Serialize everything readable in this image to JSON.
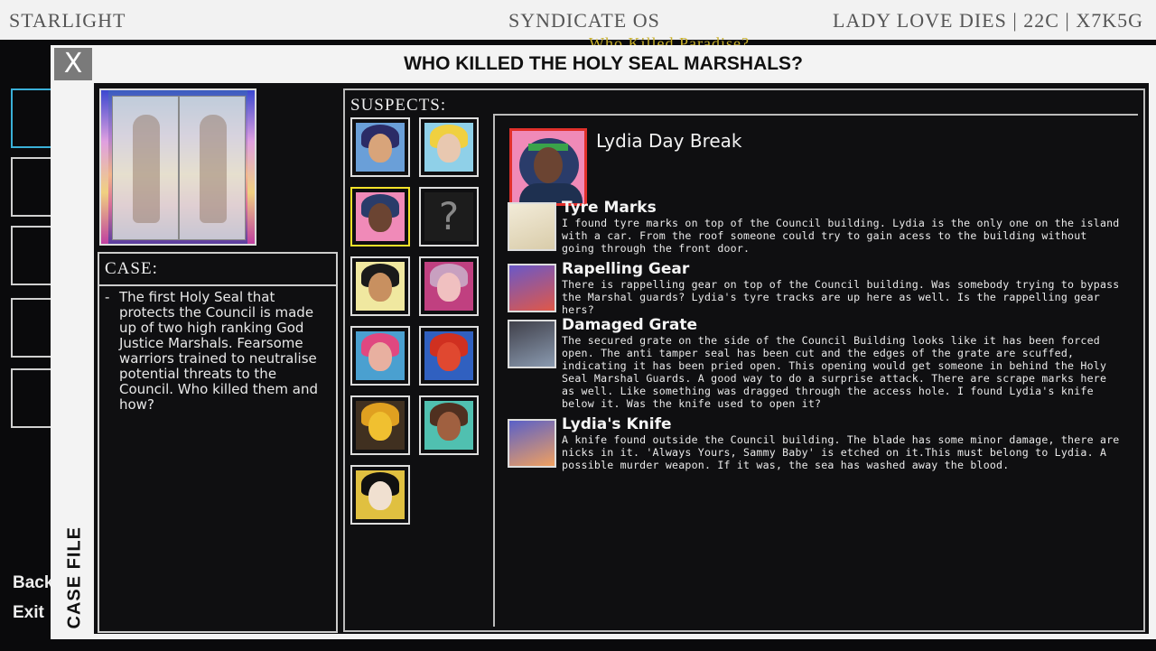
{
  "os": {
    "left_label": "STARLIGHT",
    "center_label": "SYNDICATE OS",
    "right_label": "LADY LOVE DIES | 22C | X7K5G",
    "sub_title": "Who Killed Paradise?",
    "side_labels": [
      "Back",
      "Exit"
    ]
  },
  "dialog": {
    "close_label": "X",
    "title": "WHO KILLED THE HOLY SEAL MARSHALS?",
    "tab_label": "CASE FILE"
  },
  "case": {
    "heading": "CASE:",
    "dash": "-",
    "text": "The first Holy Seal that protects the Council is made up of two high ranking God Justice Marshals. Fearsome warriors trained to neutralise potential threats to the Council. Who killed them and how?"
  },
  "suspects": {
    "heading": "SUSPECTS:",
    "unknown_label": "?",
    "list": [
      {
        "hair": "#2b2b66",
        "face": "#d8a47a",
        "bg": "#6a9fd8"
      },
      {
        "hair": "#f0d040",
        "face": "#e8c8b0",
        "bg": "#8fd0e8"
      },
      {
        "hair": "#2a3c6a",
        "face": "#6b4432",
        "bg": "#f08ab8",
        "selected": true
      },
      {
        "unknown": true
      },
      {
        "hair": "#1a1a1a",
        "face": "#c89060",
        "bg": "#f0e8a0"
      },
      {
        "hair": "#c8a0c0",
        "face": "#f0c0c0",
        "bg": "#c04080"
      },
      {
        "hair": "#e04880",
        "face": "#e8b0a0",
        "bg": "#4aa0d0"
      },
      {
        "hair": "#d03020",
        "face": "#e04830",
        "bg": "#3060c0"
      },
      {
        "hair": "#e0a020",
        "face": "#f0c030",
        "bg": "#403020"
      },
      {
        "hair": "#503020",
        "face": "#a06040",
        "bg": "#50c0b0"
      },
      {
        "hair": "#101010",
        "face": "#f0e0d0",
        "bg": "#e0c040"
      }
    ]
  },
  "selected": {
    "name": "Lydia Day Break"
  },
  "clues": [
    {
      "title": "Tyre Marks",
      "desc": "I found tyre marks on top of the Council building. Lydia is the only one on the island with a car. From the roof someone could try to gain acess to the building without going through the front door.",
      "colors": [
        "#f2ebd8",
        "#d9ccaa"
      ]
    },
    {
      "title": "Rapelling Gear",
      "desc": "There is rappelling gear on top of the Council building. Was somebody trying to bypass the Marshal guards? Lydia's tyre tracks are up here as well. Is the rappelling gear hers?",
      "colors": [
        "#6a58c8",
        "#e05848"
      ]
    },
    {
      "title": "Damaged Grate",
      "desc": "The secured grate on the side of the Council Building looks like it has been forced open. The anti tamper seal has been cut and the edges of the grate are scuffed, indicating it has been pried open. This opening would get someone in behind the Holy Seal Marshal Guards. A good way to do a surprise attack. There are scrape marks here as well. Like something was dragged through the access hole. I found Lydia's knife below it. Was the knife used to open it?",
      "colors": [
        "#40404a",
        "#8a9ab0"
      ]
    },
    {
      "title": "Lydia's Knife",
      "desc": "A knife found outside the Council building. The blade has some minor damage, there are nicks in it. 'Always Yours, Sammy Baby' is etched on it.This must belong to Lydia. A possible murder weapon. If it was, the sea has washed away the blood.",
      "colors": [
        "#5a60c8",
        "#f0a060"
      ]
    }
  ]
}
